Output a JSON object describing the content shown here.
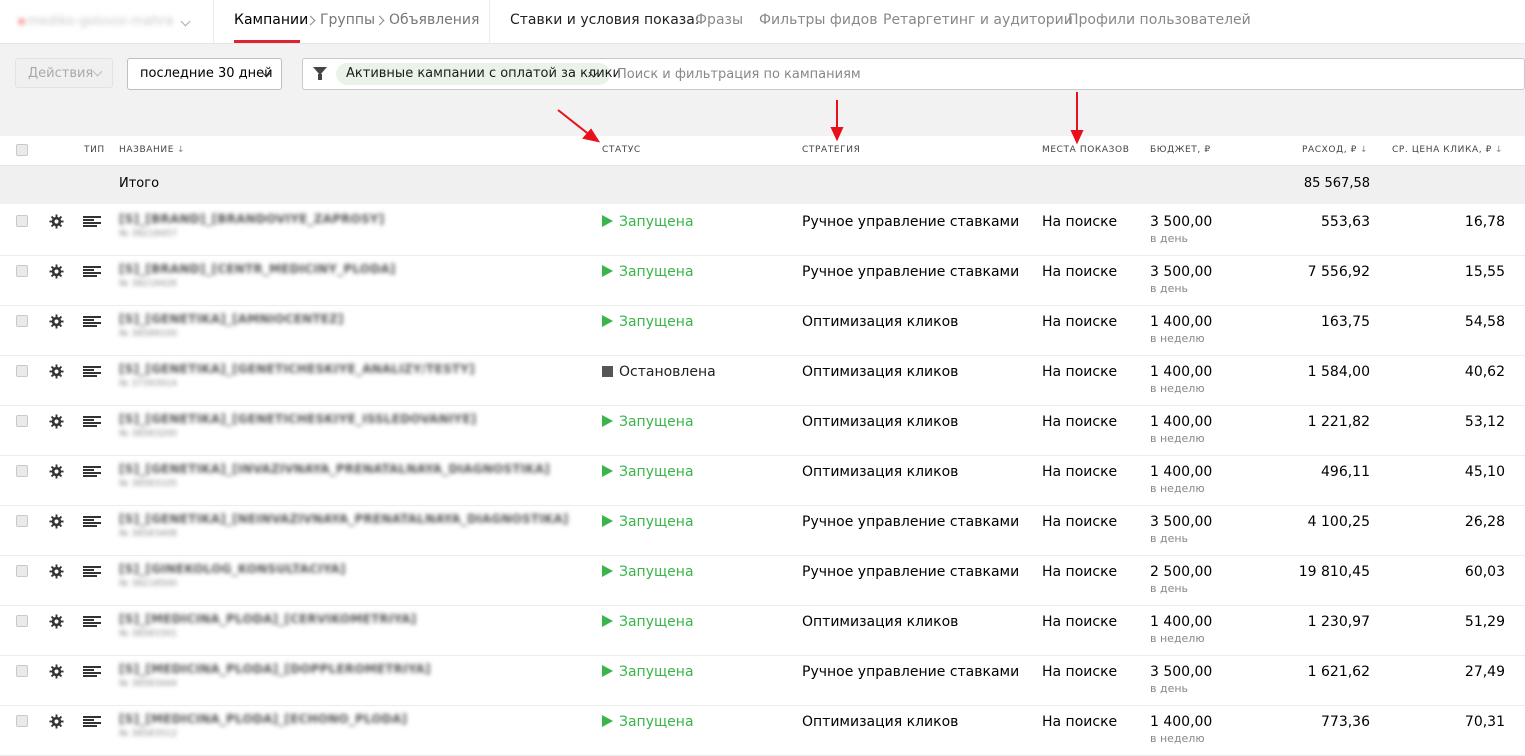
{
  "header": {
    "account": "mediko-golovoi-mahra",
    "breadcrumbs": [
      "Кампании",
      "Группы",
      "Объявления"
    ],
    "bids_label": "Ставки и условия показа:",
    "nav_links": [
      "Фразы",
      "Фильтры фидов",
      "Ретаргетинг и аудитории",
      "Профили пользователей"
    ]
  },
  "toolbar": {
    "actions_label": "Действия",
    "period_label": "последние 30 дней",
    "filter_chip": "Активные кампании с оплатой за клики",
    "search_placeholder": "Поиск и фильтрация по кампаниям"
  },
  "table": {
    "columns": {
      "type": "тип",
      "name": "название",
      "status": "статус",
      "strategy": "стратегия",
      "places": "места показов",
      "budget": "бюджет, ₽",
      "spend": "расход, ₽",
      "cpc": "ср. цена клика, ₽"
    },
    "sort_glyph": "↓",
    "totals": {
      "label": "Итого",
      "spend": "85 567,58"
    },
    "rows": [
      {
        "name": "[S]_[BRAND]_[BRANDOVIYE_ZAPROSY]",
        "id": "№ 38218457",
        "status": "Запущена",
        "status_kind": "run",
        "strategy": "Ручное управление ставками",
        "places": "На поиске",
        "budget": "3 500,00",
        "budget_period": "в день",
        "spend": "553,63",
        "cpc": "16,78"
      },
      {
        "name": "[S]_[BRAND]_[CENTR_MEDICINY_PLODA]",
        "id": "№ 38218426",
        "status": "Запущена",
        "status_kind": "run",
        "strategy": "Ручное управление ставками",
        "places": "На поиске",
        "budget": "3 500,00",
        "budget_period": "в день",
        "spend": "7 556,92",
        "cpc": "15,55"
      },
      {
        "name": "[S]_[GENETIKA]_[AMNIOCENTEZ]",
        "id": "№ 38589100",
        "status": "Запущена",
        "status_kind": "run",
        "strategy": "Оптимизация кликов",
        "places": "На поиске",
        "budget": "1 400,00",
        "budget_period": "в неделю",
        "spend": "163,75",
        "cpc": "54,58"
      },
      {
        "name": "[S]_[GENETIKA]_[GENETICHESKIYE_ANALIZY/TESTY]",
        "id": "№ 37393914",
        "status": "Остановлена",
        "status_kind": "stop",
        "strategy": "Оптимизация кликов",
        "places": "На поиске",
        "budget": "1 400,00",
        "budget_period": "в неделю",
        "spend": "1 584,00",
        "cpc": "40,62"
      },
      {
        "name": "[S]_[GENETIKA]_[GENETICHESKIYE_ISSLEDOVANIYE]",
        "id": "№ 38583200",
        "status": "Запущена",
        "status_kind": "run",
        "strategy": "Оптимизация кликов",
        "places": "На поиске",
        "budget": "1 400,00",
        "budget_period": "в неделю",
        "spend": "1 221,82",
        "cpc": "53,12"
      },
      {
        "name": "[S]_[GENETIKA]_[INVAZIVNAYA_PRENATALNAYA_DIAGNOSTIKA]",
        "id": "№ 38583105",
        "status": "Запущена",
        "status_kind": "run",
        "strategy": "Оптимизация кликов",
        "places": "На поиске",
        "budget": "1 400,00",
        "budget_period": "в неделю",
        "spend": "496,11",
        "cpc": "45,10"
      },
      {
        "name": "[S]_[GENETIKA]_[NEINVAZIVNAYA_PRENATALNAYA_DIAGNOSTIKA]",
        "id": "№ 38583408",
        "status": "Запущена",
        "status_kind": "run",
        "strategy": "Ручное управление ставками",
        "places": "На поиске",
        "budget": "3 500,00",
        "budget_period": "в день",
        "spend": "4 100,25",
        "cpc": "26,28"
      },
      {
        "name": "[S]_[GINEKOLOG_KONSULTACIYA]",
        "id": "№ 38218500",
        "status": "Запущена",
        "status_kind": "run",
        "strategy": "Ручное управление ставками",
        "places": "На поиске",
        "budget": "2 500,00",
        "budget_period": "в день",
        "spend": "19 810,45",
        "cpc": "60,03"
      },
      {
        "name": "[S]_[MEDICINA_PLODA]_[CERVIKOMETRIYA]",
        "id": "№ 38583301",
        "status": "Запущена",
        "status_kind": "run",
        "strategy": "Оптимизация кликов",
        "places": "На поиске",
        "budget": "1 400,00",
        "budget_period": "в неделю",
        "spend": "1 230,97",
        "cpc": "51,29"
      },
      {
        "name": "[S]_[MEDICINA_PLODA]_[DOPPLEROMETRIYA]",
        "id": "№ 38583444",
        "status": "Запущена",
        "status_kind": "run",
        "strategy": "Ручное управление ставками",
        "places": "На поиске",
        "budget": "3 500,00",
        "budget_period": "в день",
        "spend": "1 621,62",
        "cpc": "27,49"
      },
      {
        "name": "[S]_[MEDICINA_PLODA]_[ECHONO_PLODA]",
        "id": "№ 38583512",
        "status": "Запущена",
        "status_kind": "run",
        "strategy": "Оптимизация кликов",
        "places": "На поиске",
        "budget": "1 400,00",
        "budget_period": "в неделю",
        "spend": "773,36",
        "cpc": "70,31"
      }
    ]
  },
  "colors": {
    "accent_red": "#e0232e",
    "status_running": "#39b54a",
    "status_stopped": "#555555",
    "annotation_arrow": "#e8101a",
    "chip_bg": "#e9f3e7"
  },
  "icons": {
    "row_settings": "gear-icon",
    "row_type": "text-campaign-icon",
    "filter": "funnel-icon",
    "status_running": "play-icon",
    "status_stopped": "stop-icon"
  }
}
